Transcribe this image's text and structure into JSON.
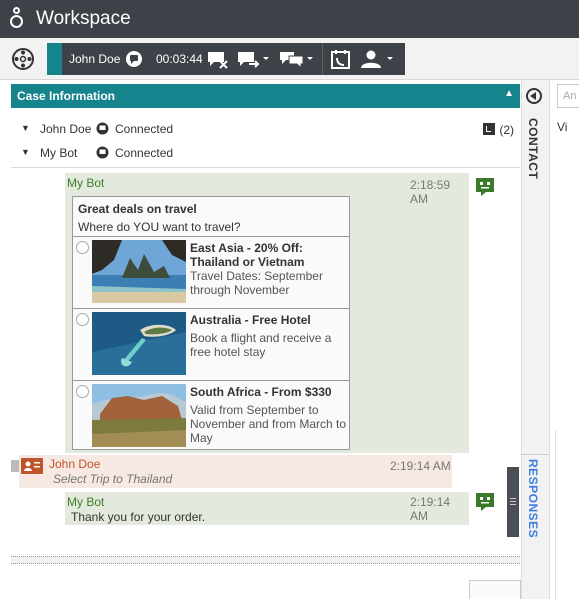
{
  "app": {
    "title": "Workspace"
  },
  "toolbar": {
    "caller_name": "John Doe",
    "timer": "00:03:44",
    "icons": [
      "settings-icon",
      "chat-icon",
      "end-chat-icon",
      "transfer-icon",
      "consult-icon",
      "schedule-callback-icon",
      "party-action-icon"
    ]
  },
  "case": {
    "title": "Case Information",
    "parties": [
      {
        "name": "John Doe",
        "status": "Connected"
      },
      {
        "name": "My Bot",
        "status": "Connected"
      }
    ],
    "history_count": "(2)"
  },
  "transcript": {
    "messages": [
      {
        "sender": "My Bot",
        "time": "2:18:59 AM",
        "card": {
          "title": "Great deals on travel",
          "subtitle": "Where do YOU want to travel?",
          "options": [
            {
              "title": "East Asia - 20% Off: Thailand or Vietnam",
              "description": "Travel Dates: September through November"
            },
            {
              "title": "Australia - Free Hotel",
              "description": "Book a flight and receive a free hotel stay"
            },
            {
              "title": "South Africa - From $330",
              "description": "Valid from September to November and from March to May"
            }
          ]
        }
      },
      {
        "sender": "John Doe",
        "time": "2:19:14 AM",
        "text": "Select Trip to Thailand"
      },
      {
        "sender": "My Bot",
        "time": "2:19:14 AM",
        "text": "Thank you for your order."
      }
    ]
  },
  "side": {
    "contact_tab": "CONTACT",
    "responses_tab": "RESPONSES",
    "search_placeholder": "An",
    "panel_label": "Vi"
  },
  "colors": {
    "accent": "#16848c",
    "bot_bubble": "#e3eadd",
    "agent_bubble": "#f6e8e2",
    "bot_name": "#3e7d28",
    "agent_name": "#c0542a"
  }
}
